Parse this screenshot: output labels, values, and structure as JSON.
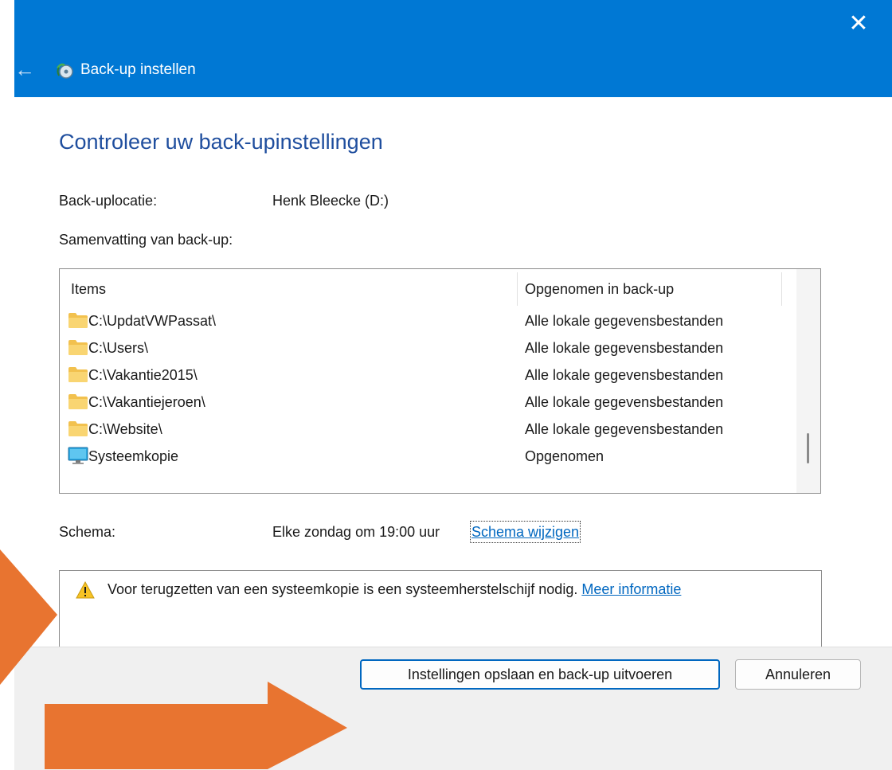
{
  "window": {
    "title": "Back-up instellen",
    "close_glyph": "✕",
    "back_glyph": "←",
    "accent": "#0078d4"
  },
  "page": {
    "heading": "Controleer uw back-upinstellingen",
    "location_label": "Back-uplocatie:",
    "location_value": "Henk Bleecke (D:)",
    "summary_label": "Samenvatting van back-up:"
  },
  "table": {
    "columns": [
      "Items",
      "Opgenomen in back-up"
    ],
    "rows": [
      {
        "icon": "folder-icon",
        "name": "C:\\UpdatVWPassat\\",
        "status": "Alle lokale gegevensbestanden"
      },
      {
        "icon": "folder-icon",
        "name": "C:\\Users\\",
        "status": "Alle lokale gegevensbestanden"
      },
      {
        "icon": "folder-icon",
        "name": "C:\\Vakantie2015\\",
        "status": "Alle lokale gegevensbestanden"
      },
      {
        "icon": "folder-icon",
        "name": "C:\\Vakantiejeroen\\",
        "status": "Alle lokale gegevensbestanden"
      },
      {
        "icon": "folder-icon",
        "name": "C:\\Website\\",
        "status": "Alle lokale gegevensbestanden"
      },
      {
        "icon": "monitor-icon",
        "name": "Systeemkopie",
        "status": "Opgenomen"
      }
    ]
  },
  "schedule": {
    "label": "Schema:",
    "value": "Elke zondag om 19:00 uur",
    "change_link": "Schema wijzigen"
  },
  "warning": {
    "text": "Voor terugzetten van een systeemkopie is een systeemherstelschijf nodig.",
    "link": "Meer informatie"
  },
  "buttons": {
    "save_run": "Instellingen opslaan en back-up uitvoeren",
    "cancel": "Annuleren"
  },
  "colors": {
    "annotation_arrow": "#e87430",
    "heading": "#1f4e9e",
    "link": "#0067c0"
  }
}
